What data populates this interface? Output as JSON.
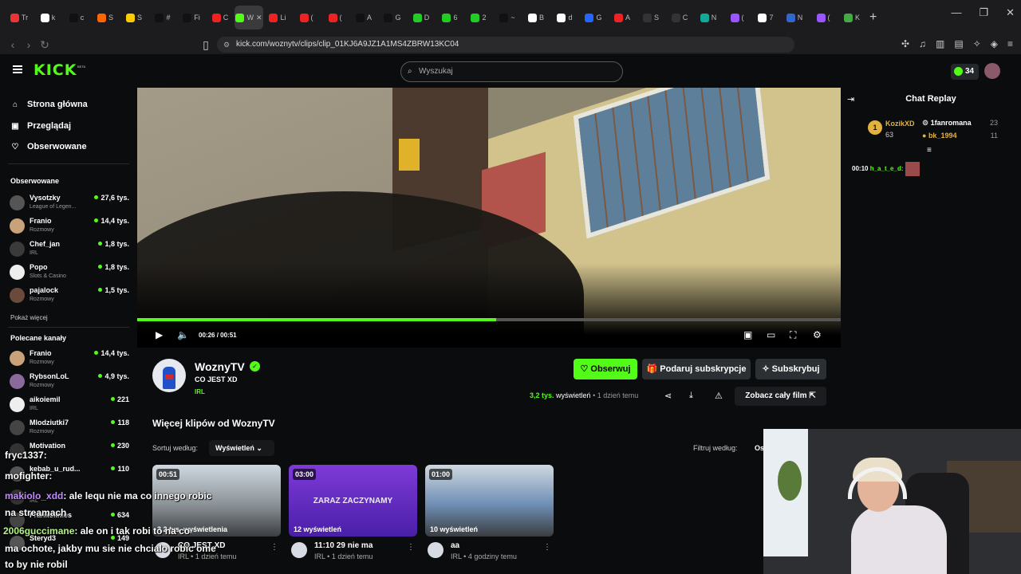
{
  "browser": {
    "url": "kick.com/woznytv/clips/clip_01KJ6A9JZ1A1MS4ZBRW13KC04",
    "tabs": [
      {
        "label": "Tr",
        "color": "#e33"
      },
      {
        "label": "k",
        "color": "#fff"
      },
      {
        "label": "c",
        "color": "#111"
      },
      {
        "label": "S",
        "color": "#f60"
      },
      {
        "label": "S",
        "color": "#fc0"
      },
      {
        "label": "#",
        "color": "#111"
      },
      {
        "label": "Fi",
        "color": "#111"
      },
      {
        "label": "C",
        "color": "#e22"
      },
      {
        "label": "W",
        "color": "#53fc18"
      },
      {
        "label": "Li",
        "color": "#e22"
      },
      {
        "label": "(",
        "color": "#e22"
      },
      {
        "label": "(",
        "color": "#e22"
      },
      {
        "label": "A",
        "color": "#111"
      },
      {
        "label": "G",
        "color": "#111"
      },
      {
        "label": "D",
        "color": "#2c2"
      },
      {
        "label": "6",
        "color": "#2c2"
      },
      {
        "label": "2",
        "color": "#2c2"
      },
      {
        "label": "~",
        "color": "#111"
      },
      {
        "label": "B",
        "color": "#fff"
      },
      {
        "label": "d",
        "color": "#fff"
      },
      {
        "label": "G",
        "color": "#26f"
      },
      {
        "label": "A",
        "color": "#e22"
      },
      {
        "label": "S",
        "color": "#333"
      },
      {
        "label": "C",
        "color": "#333"
      },
      {
        "label": "N",
        "color": "#1a9"
      },
      {
        "label": "(",
        "color": "#95f"
      },
      {
        "label": "7",
        "color": "#fff"
      },
      {
        "label": "N",
        "color": "#36c"
      },
      {
        "label": "(",
        "color": "#95f"
      },
      {
        "label": "K",
        "color": "#4a4"
      }
    ],
    "active_tab_index": 8,
    "window_controls": [
      "—",
      "❐",
      "✕"
    ]
  },
  "header": {
    "logo": "KICK",
    "logo_beta": "BETA",
    "search_placeholder": "Wyszukaj",
    "points": "34"
  },
  "sidebar": {
    "nav": [
      {
        "label": "Strona główna",
        "icon": "home-icon",
        "glyph": "⌂"
      },
      {
        "label": "Przeglądaj",
        "icon": "browse-icon",
        "glyph": "▣"
      },
      {
        "label": "Obserwowane",
        "icon": "heart-icon",
        "glyph": "♡"
      }
    ],
    "followed_title": "Obserwowane",
    "followed": [
      {
        "name": "Vysotzky",
        "category": "League of Legen...",
        "viewers": "27,6 tys.",
        "color": "#555"
      },
      {
        "name": "Franio",
        "category": "Rozmowy",
        "viewers": "14,4 tys.",
        "color": "#c9a27a"
      },
      {
        "name": "Chef_jan",
        "category": "IRL",
        "viewers": "1,8 tys.",
        "color": "#3a3a3a"
      },
      {
        "name": "Popo",
        "category": "Slots & Casino",
        "viewers": "1,8 tys.",
        "color": "#eee"
      },
      {
        "name": "pajalock",
        "category": "Rozmowy",
        "viewers": "1,5 tys.",
        "color": "#6a4a3a"
      }
    ],
    "show_more": "Pokaż więcej",
    "recommended_title": "Polecane kanały",
    "recommended": [
      {
        "name": "Franio",
        "category": "Rozmowy",
        "viewers": "14,4 tys.",
        "color": "#c9a27a"
      },
      {
        "name": "RybsonLoL",
        "category": "Rozmowy",
        "viewers": "4,9 tys.",
        "color": "#8a6a9a"
      },
      {
        "name": "aikoiemil",
        "category": "IRL",
        "viewers": "221",
        "color": "#eee"
      },
      {
        "name": "Mlodziutki7",
        "category": "Rozmowy",
        "viewers": "118",
        "color": "#444"
      },
      {
        "name": "Motivation",
        "category": "",
        "viewers": "230",
        "color": "#333"
      },
      {
        "name": "kebab_u_rud...",
        "category": "",
        "viewers": "110",
        "color": "#555"
      },
      {
        "name": "",
        "category": "IRL",
        "viewers": "",
        "color": "#333"
      },
      {
        "name": "Frankolinies",
        "category": "",
        "viewers": "634",
        "color": "#444"
      },
      {
        "name": "Steryd3",
        "category": "",
        "viewers": "149",
        "color": "#555"
      }
    ]
  },
  "player": {
    "current_time": "00:26",
    "duration": "00:51",
    "progress_fraction": 0.51
  },
  "chat_replay": {
    "title": "Chat Replay",
    "gifter_badge": "1",
    "top_gifter": {
      "name": "KozikXD",
      "count": "63"
    },
    "gifters": [
      {
        "name": "1fanromana",
        "count": "23",
        "color": "#fff"
      },
      {
        "name": "bk_1994",
        "count": "11",
        "color": "#e3b23c"
      }
    ],
    "messages": [
      {
        "time": "00:10",
        "user": "h_a_t_e_d:",
        "user_color": "#53fc18"
      }
    ]
  },
  "channel": {
    "name": "WoznyTV",
    "clip_title": "CO JEST XD",
    "category": "IRL",
    "follow_label": "♡ Obserwuj",
    "gift_label": "🎁 Podaruj subskrypcje",
    "sub_label": "✧ Subskrybuj",
    "views_count": "3,2 tys.",
    "views_word": "wyświetleń",
    "age": "• 1 dzień temu",
    "watch_full_label": "Zobacz cały film ⇱",
    "more_clips_title": "Więcej klipów od WoznyTV",
    "sort_label": "Sortuj według:",
    "sort_value": "Wyświetleń ⌄",
    "filter_label": "Filtruj według:",
    "filter_value": "Os"
  },
  "clips": [
    {
      "duration": "00:51",
      "views": "3,2 tys. wyświetlenia",
      "title": "CO JEST XD",
      "meta": "IRL • 1 dzień temu",
      "thumb": "#8c9398",
      "text": ""
    },
    {
      "duration": "03:00",
      "views": "12 wyświetleń",
      "title": "11:10 29 nie ma",
      "meta": "IRL • 1 dzień temu",
      "thumb": "#6a2fd0",
      "text": "ZARAZ ZACZYNAMY"
    },
    {
      "duration": "01:00",
      "views": "10 wyświetleń",
      "title": "aa",
      "meta": "IRL • 4 godziny temu",
      "thumb": "#6f8fb5",
      "text": ""
    }
  ],
  "overlay_chat": [
    {
      "user": "fryc1337",
      "text": ":"
    },
    {
      "user": "mofighter",
      "text": ":"
    },
    {
      "user": "makiolo_xdd",
      "text": ": ale lequ nie ma co innego robic"
    },
    {
      "user": "",
      "text": "na streamach"
    },
    {
      "user": "2006guccimane",
      "text": ": ale on i tak robi to na co"
    },
    {
      "user": "",
      "text": "ma ochote, jakby mu sie nie chcialo robic ome"
    },
    {
      "user": "",
      "text": "to by nie robil"
    }
  ]
}
